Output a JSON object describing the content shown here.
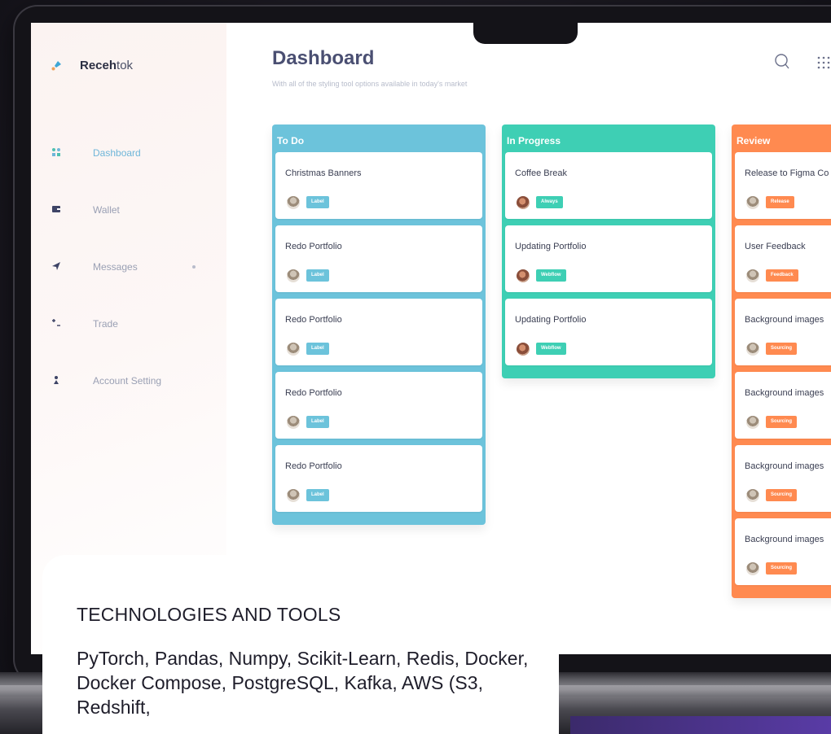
{
  "brand": {
    "name_bold": "Receh",
    "name_rest": "tok"
  },
  "sidebar": {
    "items": [
      {
        "label": "Dashboard",
        "icon": "dashboard-icon",
        "active": true
      },
      {
        "label": "Wallet",
        "icon": "wallet-icon",
        "active": false
      },
      {
        "label": "Messages",
        "icon": "send-icon",
        "active": false
      },
      {
        "label": "Trade",
        "icon": "trade-icon",
        "active": false
      },
      {
        "label": "Account Setting",
        "icon": "user-icon",
        "active": false
      }
    ]
  },
  "header": {
    "title": "Dashboard",
    "subtitle": "With all of the styling tool options available in today's market"
  },
  "colors": {
    "todo": "#6cc3db",
    "in_progress": "#3ecfb4",
    "review": "#ff8a50"
  },
  "board": {
    "columns": [
      {
        "title": "To Do",
        "cards": [
          {
            "title": "Christmas Banners",
            "tag": "Label"
          },
          {
            "title": "Redo Portfolio",
            "tag": "Label"
          },
          {
            "title": "Redo Portfolio",
            "tag": "Label"
          },
          {
            "title": "Redo Portfolio",
            "tag": "Label"
          },
          {
            "title": "Redo Portfolio",
            "tag": "Label"
          }
        ]
      },
      {
        "title": "In Progress",
        "cards": [
          {
            "title": "Coffee Break",
            "tag": "Always"
          },
          {
            "title": "Updating Portfolio",
            "tag": "Webflow"
          },
          {
            "title": "Updating Portfolio",
            "tag": "Webflow"
          }
        ]
      },
      {
        "title": "Review",
        "cards": [
          {
            "title": "Release to Figma Co",
            "tag": "Release"
          },
          {
            "title": "User Feedback",
            "tag": "Feedback"
          },
          {
            "title": "Background images",
            "tag": "Sourcing"
          },
          {
            "title": "Background images",
            "tag": "Sourcing"
          },
          {
            "title": "Background images",
            "tag": "Sourcing"
          },
          {
            "title": "Background images",
            "tag": "Sourcing"
          }
        ]
      }
    ]
  },
  "overlay": {
    "heading": "TECHNOLOGIES AND TOOLS",
    "body": "PyTorch, Pandas, Numpy, Scikit-Learn, Redis, Docker, Docker Compose, PostgreSQL, Kafka, AWS (S3, Redshift,"
  }
}
